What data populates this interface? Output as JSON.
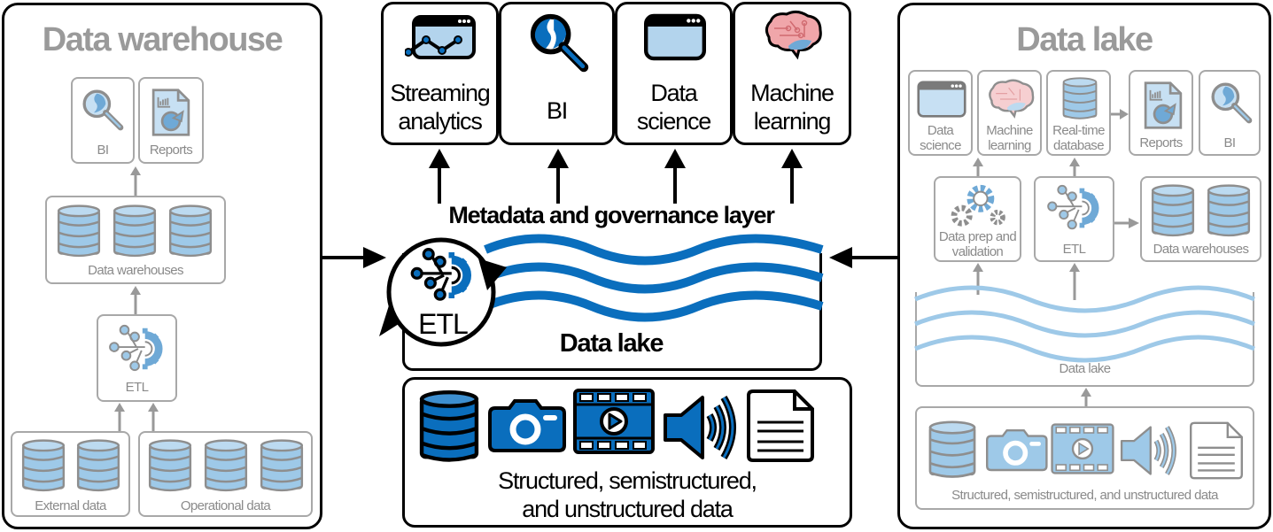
{
  "colors": {
    "accent_blue": "#0a6ebd",
    "light_blue": "#9ec9e8",
    "pale_blue": "#c7e0f3",
    "grey": "#9a9a9a",
    "brain_pink": "#f0a6aa"
  },
  "left_panel": {
    "title": "Data warehouse",
    "top_boxes": [
      {
        "label": "BI",
        "icon": "magnifier-icon"
      },
      {
        "label": "Reports",
        "icon": "report-document-icon"
      }
    ],
    "warehouses_label": "Data warehouses",
    "etl_label": "ETL",
    "sources": [
      {
        "label": "External data",
        "db_count": 2
      },
      {
        "label": "Operational data",
        "db_count": 3
      }
    ]
  },
  "center": {
    "consumers": [
      {
        "label_lines": [
          "Streaming",
          "analytics"
        ],
        "icon": "line-chart-window-icon"
      },
      {
        "label_lines": [
          "BI"
        ],
        "icon": "magnifier-icon"
      },
      {
        "label_lines": [
          "Data",
          "science"
        ],
        "icon": "browser-window-icon"
      },
      {
        "label_lines": [
          "Machine",
          "learning"
        ],
        "icon": "brain-icon"
      }
    ],
    "governance_label": "Metadata and governance layer",
    "etl_label": "ETL",
    "lake_label": "Data lake",
    "sources_icons": [
      "database-icon",
      "camera-icon",
      "video-film-icon",
      "speaker-icon",
      "document-icon"
    ],
    "sources_label_lines": [
      "Structured, semistructured,",
      "and unstructured data"
    ]
  },
  "right_panel": {
    "title": "Data lake",
    "top_boxes": [
      {
        "label_lines": [
          "Data",
          "science"
        ],
        "icon": "browser-window-icon"
      },
      {
        "label_lines": [
          "Machine",
          "learning"
        ],
        "icon": "brain-icon"
      },
      {
        "label_lines": [
          "Real-time",
          "database"
        ],
        "icon": "database-icon"
      },
      {
        "label_lines": [
          "Reports"
        ],
        "icon": "report-document-icon"
      },
      {
        "label_lines": [
          "BI"
        ],
        "icon": "magnifier-icon"
      }
    ],
    "middle_boxes": [
      {
        "label_lines": [
          "Data prep and",
          "validation"
        ],
        "icon": "gears-icon"
      },
      {
        "label_lines": [
          "ETL"
        ],
        "icon": "etl-gear-icon"
      },
      {
        "label_lines": [
          "Data warehouses"
        ],
        "icon": "database-icon"
      }
    ],
    "lake_label": "Data lake",
    "sources_label": "Structured, semistructured, and unstructured data"
  }
}
